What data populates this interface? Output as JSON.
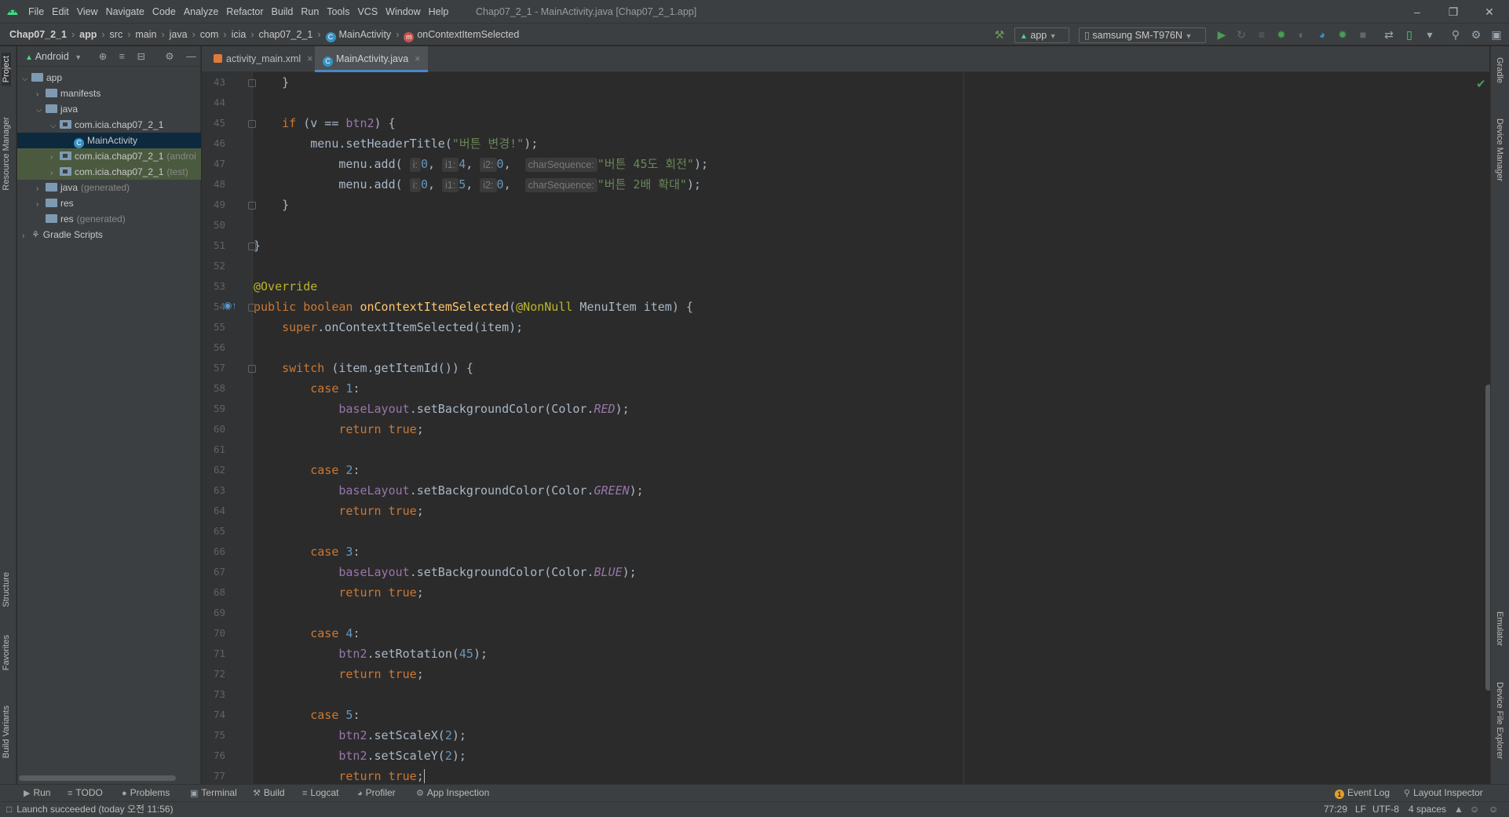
{
  "menu": [
    "File",
    "Edit",
    "View",
    "Navigate",
    "Code",
    "Analyze",
    "Refactor",
    "Build",
    "Run",
    "Tools",
    "VCS",
    "Window",
    "Help"
  ],
  "window_title": "Chap07_2_1 - MainActivity.java [Chap07_2_1.app]",
  "breadcrumbs": [
    "Chap07_2_1",
    "app",
    "src",
    "main",
    "java",
    "com",
    "icia",
    "chap07_2_1",
    "MainActivity",
    "onContextItemSelected"
  ],
  "toolbar": {
    "config": "app",
    "device": "samsung SM-T976N"
  },
  "left_strip": [
    "Project",
    "Resource Manager",
    "Structure",
    "Favorites",
    "Build Variants"
  ],
  "right_strip": [
    "Gradle",
    "Device Manager",
    "Emulator",
    "Device File Explorer"
  ],
  "project": {
    "view": "Android",
    "tree": [
      {
        "label": "app",
        "suffix": "",
        "depth": 0,
        "arrow": "v"
      },
      {
        "label": "manifests",
        "suffix": "",
        "depth": 1,
        "arrow": ">"
      },
      {
        "label": "java",
        "suffix": "",
        "depth": 1,
        "arrow": "v"
      },
      {
        "label": "com.icia.chap07_2_1",
        "suffix": "",
        "depth": 2,
        "arrow": "v"
      },
      {
        "label": "MainActivity",
        "suffix": "",
        "depth": 3,
        "arrow": ""
      },
      {
        "label": "com.icia.chap07_2_1",
        "suffix": "(androi",
        "depth": 2,
        "arrow": ">"
      },
      {
        "label": "com.icia.chap07_2_1",
        "suffix": "(test)",
        "depth": 2,
        "arrow": ">"
      },
      {
        "label": "java",
        "suffix": "(generated)",
        "depth": 1,
        "arrow": ">"
      },
      {
        "label": "res",
        "suffix": "",
        "depth": 1,
        "arrow": ">"
      },
      {
        "label": "res",
        "suffix": "(generated)",
        "depth": 1,
        "arrow": ""
      },
      {
        "label": "Gradle Scripts",
        "suffix": "",
        "depth": 0,
        "arrow": ">"
      }
    ]
  },
  "tabs": [
    {
      "label": "activity_main.xml",
      "active": false
    },
    {
      "label": "MainActivity.java",
      "active": true
    }
  ],
  "editor": {
    "line_numbers": [
      "43",
      "44",
      "45",
      "46",
      "47",
      "48",
      "49",
      "50",
      "51",
      "52",
      "53",
      "54",
      "55",
      "56",
      "57",
      "58",
      "59",
      "60",
      "61",
      "62",
      "63",
      "64",
      "65",
      "66",
      "67",
      "68",
      "69",
      "70",
      "71",
      "72",
      "73",
      "74",
      "75",
      "76",
      "77"
    ],
    "hints": {
      "i": "i:",
      "i1": "i1:",
      "i2": "i2:",
      "cs": "charSequence:"
    }
  },
  "bottom_tools": [
    "Run",
    "TODO",
    "Problems",
    "Terminal",
    "Build",
    "Logcat",
    "Profiler",
    "App Inspection"
  ],
  "bottom_right_tools": [
    "Event Log",
    "Layout Inspector"
  ],
  "status": {
    "message": "Launch succeeded (today 오전 11:56)",
    "position": "77:29",
    "line_sep": "LF",
    "encoding": "UTF-8",
    "indent": "4 spaces"
  },
  "colors": {
    "keyword": "#cc7832",
    "string": "#6a8759",
    "number": "#6897bb",
    "field": "#9876aa",
    "annotation": "#bbb529",
    "method_decl": "#ffc66d",
    "selection": "#0d293e"
  }
}
